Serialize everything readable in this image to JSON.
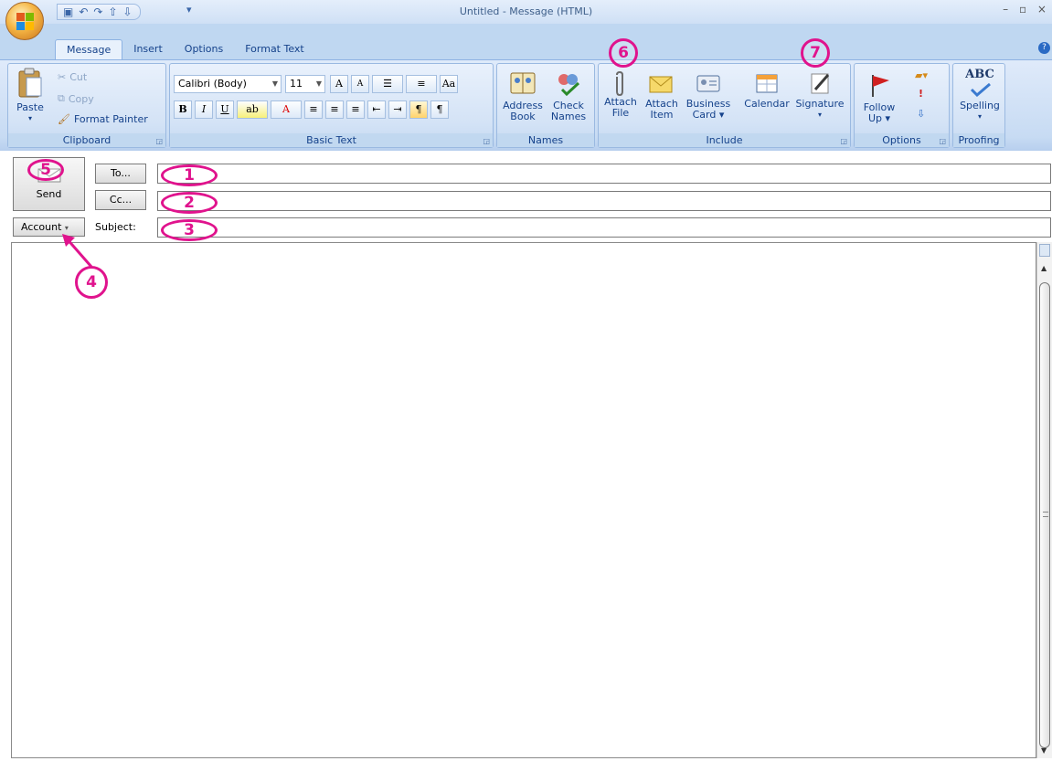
{
  "window": {
    "title": "Untitled - Message (HTML)",
    "controls": "– ▫ ×"
  },
  "quick_access": {
    "items": [
      "save-icon",
      "undo-icon",
      "redo-icon",
      "up-icon",
      "down-icon"
    ],
    "more": "▾"
  },
  "tabs": [
    {
      "label": "Message",
      "active": true
    },
    {
      "label": "Insert",
      "active": false
    },
    {
      "label": "Options",
      "active": false
    },
    {
      "label": "Format Text",
      "active": false
    }
  ],
  "ribbon": {
    "clipboard": {
      "label": "Clipboard",
      "paste": "Paste",
      "cut": "Cut",
      "copy": "Copy",
      "format_painter": "Format Painter"
    },
    "basic_text": {
      "label": "Basic Text",
      "font": "Calibri (Body)",
      "size": "11"
    },
    "names": {
      "label": "Names",
      "address_book_1": "Address",
      "address_book_2": "Book",
      "check_names_1": "Check",
      "check_names_2": "Names"
    },
    "include": {
      "label": "Include",
      "attach_file_1": "Attach",
      "attach_file_2": "File",
      "attach_item_1": "Attach",
      "attach_item_2": "Item",
      "business_card_1": "Business",
      "business_card_2": "Card ▾",
      "calendar": "Calendar",
      "signature": "Signature"
    },
    "options": {
      "label": "Options",
      "follow_up_1": "Follow",
      "follow_up_2": "Up ▾"
    },
    "proofing": {
      "label": "Proofing",
      "spelling": "Spelling",
      "abc": "ABC"
    }
  },
  "envelope": {
    "send": "Send",
    "to": "To...",
    "cc": "Cc...",
    "account": "Account",
    "subject_label": "Subject:"
  },
  "annotations": {
    "a1": "1",
    "a2": "2",
    "a3": "3",
    "a4": "4",
    "a5": "5",
    "a6": "6",
    "a7": "7",
    "color": "#e0138d"
  }
}
